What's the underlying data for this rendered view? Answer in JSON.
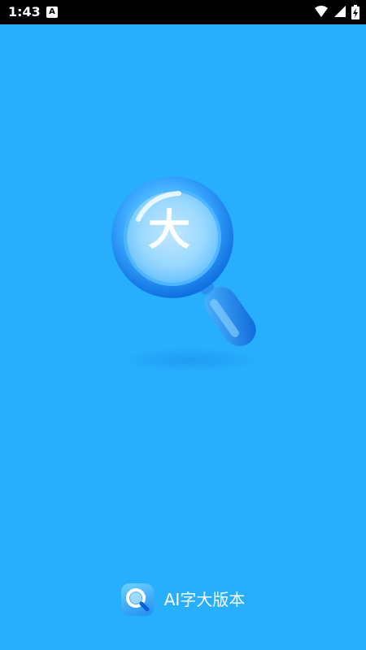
{
  "status_bar": {
    "time": "1:43",
    "notification_badge": "A",
    "icons": [
      "wifi-icon",
      "signal-icon",
      "battery-icon"
    ]
  },
  "splash": {
    "logo_character": "大",
    "logo_icon": "magnifier-icon"
  },
  "brand": {
    "app_name": "AI字大版本",
    "icon": "app-icon"
  },
  "colors": {
    "background": "#27aefc",
    "status_bar": "#000000",
    "text": "#ffffff"
  }
}
